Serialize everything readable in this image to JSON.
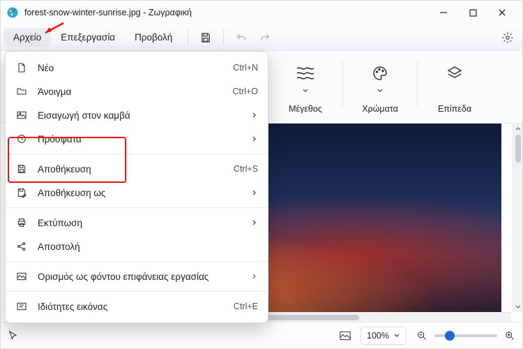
{
  "window": {
    "title": "forest-snow-winter-sunrise.jpg - Ζωγραφική"
  },
  "menubar": {
    "file": "Αρχείο",
    "edit": "Επεξεργασία",
    "view": "Προβολή"
  },
  "ribbon": {
    "size": "Μέγεθος",
    "colors": "Χρώματα",
    "layers": "Επίπεδα"
  },
  "dropdown": {
    "new": {
      "label": "Νέο",
      "accel": "Ctrl+N"
    },
    "open": {
      "label": "Άνοιγμα",
      "accel": "Ctrl+O"
    },
    "import": {
      "label": "Εισαγωγή στον καμβά"
    },
    "recent": {
      "label": "Πρόσφατα"
    },
    "save": {
      "label": "Αποθήκευση",
      "accel": "Ctrl+S"
    },
    "saveas": {
      "label": "Αποθήκευση ως"
    },
    "print": {
      "label": "Εκτύπωση"
    },
    "send": {
      "label": "Αποστολή"
    },
    "wallpaper": {
      "label": "Ορισμός ως φόντου επιφάνειας εργασίας"
    },
    "props": {
      "label": "Ιδιότητες εικόνας",
      "accel": "Ctrl+E"
    }
  },
  "status": {
    "zoom_value": "100%"
  },
  "colors": {
    "accent": "#1f67d2",
    "annotation": "#e11"
  }
}
